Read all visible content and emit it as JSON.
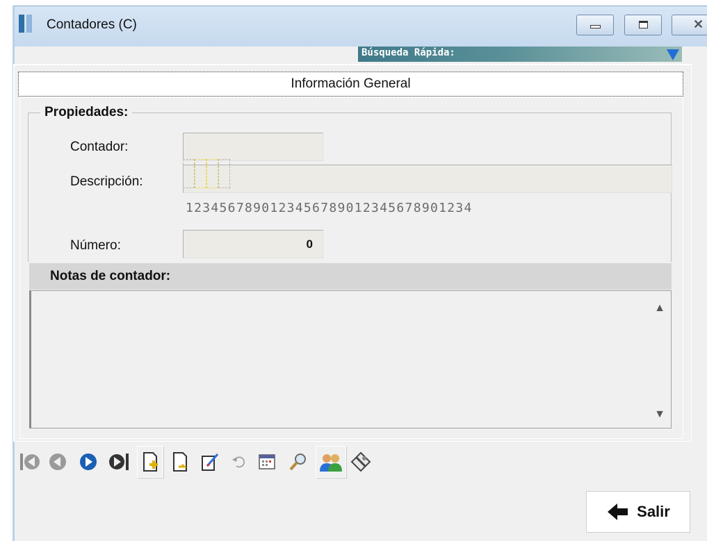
{
  "window": {
    "title": "Contadores (C)",
    "icon": "app-icon",
    "controls": [
      "minimize-icon",
      "maximize-icon",
      "close-icon"
    ]
  },
  "quick_search": {
    "label": "Búsqueda Rápida:",
    "dropdown_icon": "triangle-down-icon",
    "accent": "#1f6fd6"
  },
  "tab": {
    "label": "Información General"
  },
  "properties": {
    "legend": "Propiedades:",
    "contador_label": "Contador:",
    "contador_value": "",
    "descripcion_label": "Descripción:",
    "descripcion_value": "",
    "ruler": "1234567890123456789012345678901234",
    "numero_label": "Número:",
    "numero_value": "0"
  },
  "notes": {
    "header": "Notas de contador:",
    "value": ""
  },
  "toolbar": {
    "buttons": [
      {
        "name": "first-record",
        "icon": "first-icon"
      },
      {
        "name": "previous-record",
        "icon": "previous-icon"
      },
      {
        "name": "next-record",
        "icon": "next-icon"
      },
      {
        "name": "last-record",
        "icon": "last-icon"
      },
      {
        "name": "new-record",
        "icon": "new-document-icon"
      },
      {
        "name": "save-record",
        "icon": "save-document-icon"
      },
      {
        "name": "edit-record",
        "icon": "edit-icon"
      },
      {
        "name": "undo",
        "icon": "undo-icon"
      },
      {
        "name": "calendar",
        "icon": "calendar-icon"
      },
      {
        "name": "search",
        "icon": "magnifier-icon"
      },
      {
        "name": "users",
        "icon": "users-icon"
      },
      {
        "name": "tools",
        "icon": "tools-icon"
      }
    ]
  },
  "exit_button": {
    "label": "Salir",
    "icon": "arrow-left-icon"
  },
  "colors": {
    "titlebar": "#c6d9ee",
    "quick_search_bg": "#3f7a8a",
    "nav_blue": "#1a5fb4",
    "window_bg": "#f0f0f0"
  }
}
